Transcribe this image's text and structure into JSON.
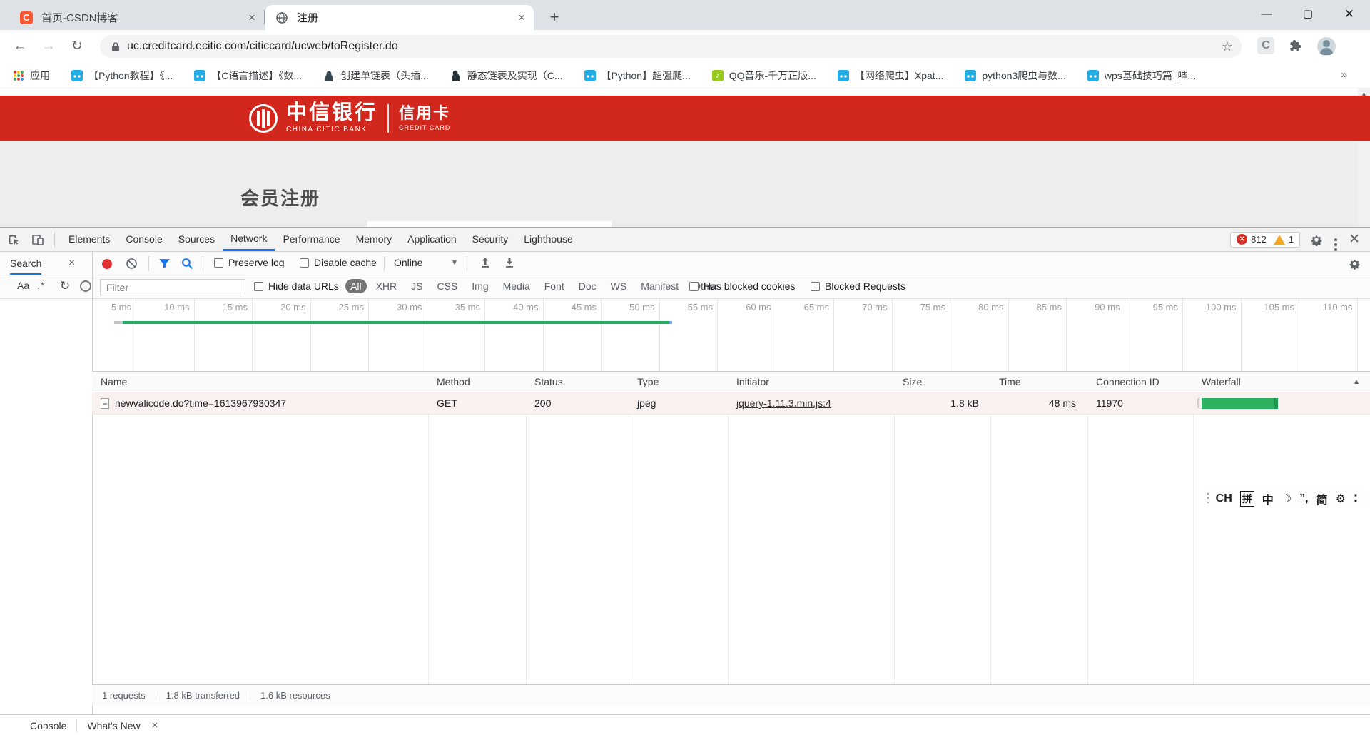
{
  "browser": {
    "tabs": [
      {
        "title": "首页-CSDN博客",
        "favicon": "csdn",
        "close_label": "×"
      },
      {
        "title": "注册",
        "favicon": "globe",
        "close_label": "×"
      }
    ],
    "new_tab_label": "+",
    "window_controls": {
      "minimize": "—",
      "maximize": "▢",
      "close": "✕"
    },
    "nav": {
      "back": "←",
      "forward": "→",
      "reload": "↻"
    },
    "url": "uc.creditcard.ecitic.com/citiccard/ucweb/toRegister.do",
    "star": "☆",
    "ext_badge": "C",
    "bookmarks": [
      {
        "label": "应用",
        "icon": "apps-grid"
      },
      {
        "label": "【Python教程】《...",
        "icon": "bilibili"
      },
      {
        "label": "【C语言描述】《数...",
        "icon": "bilibili"
      },
      {
        "label": "创建单链表（头插...",
        "icon": "person"
      },
      {
        "label": "静态链表及实现（C...",
        "icon": "person-dark"
      },
      {
        "label": "【Python】超强爬...",
        "icon": "bilibili"
      },
      {
        "label": "QQ音乐-千万正版...",
        "icon": "qq-music"
      },
      {
        "label": "【网络爬虫】Xpat...",
        "icon": "bilibili"
      },
      {
        "label": "python3爬虫与数...",
        "icon": "bilibili"
      },
      {
        "label": "wps基础技巧篇_哔...",
        "icon": "bilibili"
      }
    ],
    "bookmarks_overflow": "»"
  },
  "page": {
    "banner": {
      "bank_cn": "中信银行",
      "bank_en": "CHINA CITIC BANK",
      "product_cn": "信用卡",
      "product_en": "CREDIT CARD",
      "bg_color": "#d2271c"
    },
    "heading": "会员注册"
  },
  "devtools": {
    "panels": [
      "Elements",
      "Console",
      "Sources",
      "Network",
      "Performance",
      "Memory",
      "Application",
      "Security",
      "Lighthouse"
    ],
    "active_panel": "Network",
    "errors": "812",
    "warnings": "1",
    "search_pane": {
      "tab_label": "Search",
      "close_label": "×",
      "match_case": "Aa",
      "regex": ".*"
    },
    "toolbar": {
      "preserve_log": "Preserve log",
      "disable_cache": "Disable cache",
      "throttling": "Online",
      "throttle_arrow": "▼"
    },
    "filter": {
      "placeholder": "Filter",
      "hide_data_urls": "Hide data URLs",
      "pills": [
        "All",
        "XHR",
        "JS",
        "CSS",
        "Img",
        "Media",
        "Font",
        "Doc",
        "WS",
        "Manifest",
        "Other"
      ],
      "selected_pill": "All",
      "has_blocked_cookies": "Has blocked cookies",
      "blocked_requests": "Blocked Requests"
    },
    "timeline": {
      "ticks": [
        "5 ms",
        "10 ms",
        "15 ms",
        "20 ms",
        "25 ms",
        "30 ms",
        "35 ms",
        "40 ms",
        "45 ms",
        "50 ms",
        "55 ms",
        "60 ms",
        "65 ms",
        "70 ms",
        "75 ms",
        "80 ms",
        "85 ms",
        "90 ms",
        "95 ms",
        "100 ms",
        "105 ms",
        "110 ms"
      ],
      "overview_bar_color": "#27ae60"
    },
    "table": {
      "headers": [
        "Name",
        "Method",
        "Status",
        "Type",
        "Initiator",
        "Size",
        "Time",
        "Connection ID",
        "Waterfall"
      ],
      "sort_indicator": "▲",
      "rows": [
        {
          "name": "newvalicode.do?time=1613967930347",
          "method": "GET",
          "status": "200",
          "type": "jpeg",
          "initiator": "jquery-1.11.3.min.js:4",
          "size": "1.8 kB",
          "time": "48 ms",
          "connection_id": "11970"
        }
      ]
    },
    "summary": [
      "1 requests",
      "1.8 kB transferred",
      "1.6 kB resources"
    ],
    "drawer": {
      "tabs": [
        "Console",
        "What's New"
      ],
      "close_label": "×"
    }
  },
  "ime": {
    "items": [
      {
        "t": "CH"
      },
      {
        "t": "拼",
        "style": "boxed"
      },
      {
        "t": "中"
      },
      {
        "t": "☽"
      },
      {
        "t": "”,"
      },
      {
        "t": "简"
      },
      {
        "t": "⚙"
      },
      {
        "t": "⁚"
      }
    ]
  }
}
